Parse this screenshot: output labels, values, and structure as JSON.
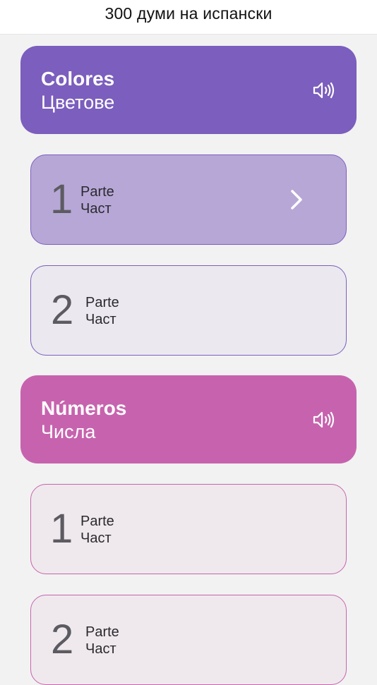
{
  "header": {
    "title": "300 думи на испански"
  },
  "colors": {
    "purple_dark": "#7b5ebd",
    "purple_light": "#b7a7d7",
    "purple_border": "#7b5ebd",
    "purple_tint": "#ebe9ef",
    "pink_dark": "#c763ae",
    "pink_border": "#c763ae",
    "pink_tint": "#efe9ed"
  },
  "categories": [
    {
      "title": "Colores",
      "subtitle": "Цветове",
      "parts": [
        {
          "number": "1",
          "title": "Parte",
          "subtitle": "Част",
          "selected": true
        },
        {
          "number": "2",
          "title": "Parte",
          "subtitle": "Част",
          "selected": false
        }
      ]
    },
    {
      "title": "Números",
      "subtitle": "Числа",
      "parts": [
        {
          "number": "1",
          "title": "Parte",
          "subtitle": "Част",
          "selected": false
        },
        {
          "number": "2",
          "title": "Parte",
          "subtitle": "Част",
          "selected": false
        }
      ]
    }
  ]
}
